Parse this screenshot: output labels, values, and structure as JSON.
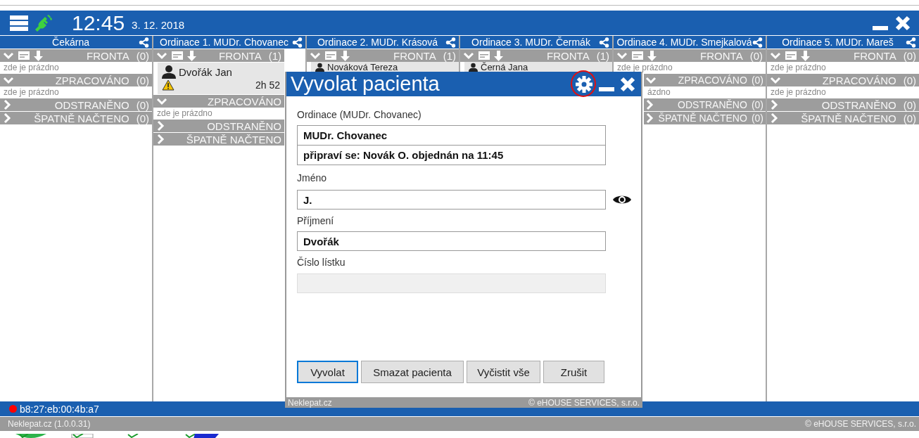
{
  "header": {
    "time": "12:45",
    "date": "3. 12. 2018",
    "connected": true
  },
  "columns": [
    {
      "title": "Čekárna",
      "sections": [
        {
          "kind": "queue",
          "label": "FRONTA",
          "count": "(0)",
          "expanded": true,
          "note": "zde je prázdno"
        },
        {
          "kind": "group",
          "label": "ZPRACOVÁNO",
          "count": "(0)",
          "expanded": true,
          "note": "zde je prázdno"
        },
        {
          "kind": "group",
          "label": "ODSTRANĚNO",
          "count": "(0)",
          "expanded": false
        },
        {
          "kind": "group",
          "label": "ŠPATNĚ NAČTENO",
          "count": "(0)",
          "expanded": false
        }
      ]
    },
    {
      "title": "Ordinace 1. MUDr. Chovanec",
      "sections": [
        {
          "kind": "queue",
          "label": "FRONTA",
          "count": "(1)",
          "expanded": true,
          "patients": [
            {
              "name": "Dvořák Jan",
              "warning": true,
              "wait": "2h 52"
            }
          ]
        },
        {
          "kind": "group",
          "label": "ZPRACOVÁNO",
          "expanded": true,
          "note": "zde je prázdno"
        },
        {
          "kind": "group",
          "label": "ODSTRANĚNO",
          "expanded": false
        },
        {
          "kind": "group",
          "label": "ŠPATNĚ NAČTENO",
          "expanded": false
        }
      ]
    },
    {
      "title": "Ordinace 2. MUDr. Krásová",
      "sections": [
        {
          "kind": "queue",
          "label": "FRONTA",
          "count": "(1)",
          "expanded": true,
          "patients": [
            {
              "name": "Nováková Tereza"
            }
          ]
        }
      ]
    },
    {
      "title": "Ordinace 3. MUDr. Čermák",
      "sections": [
        {
          "kind": "queue",
          "label": "FRONTA",
          "count": "(1)",
          "expanded": true,
          "patients": [
            {
              "name": "Černá Jana"
            }
          ]
        }
      ]
    },
    {
      "title": "Ordinace 4. MUDr. Smejkalová",
      "sections": [
        {
          "kind": "queue",
          "label": "FRONTA",
          "count": "(0)",
          "expanded": true,
          "note": "zde je prázdno"
        },
        {
          "kind": "group",
          "label": "ZPRACOVÁNO",
          "count": "(0)",
          "expanded": true,
          "note": "ázdno"
        },
        {
          "kind": "group",
          "label": "ODSTRANĚNO",
          "count": "(0)",
          "expanded": false
        },
        {
          "kind": "group",
          "label": "ŠPATNĚ NAČTENO",
          "count": "(0)",
          "expanded": false
        }
      ]
    },
    {
      "title": "Ordinace 5. MUDr. Mareš",
      "sections": [
        {
          "kind": "queue",
          "label": "FRONTA",
          "count": "(0)",
          "expanded": true,
          "note": "zde je prázdno"
        },
        {
          "kind": "group",
          "label": "ZPRACOVÁNO",
          "count": "(0)",
          "expanded": true,
          "note": "zde je prázdno"
        },
        {
          "kind": "group",
          "label": "ODSTRANĚNO",
          "count": "(0)",
          "expanded": false
        },
        {
          "kind": "group",
          "label": "ŠPATNĚ NAČTENO",
          "count": "(0)",
          "expanded": false
        }
      ]
    }
  ],
  "dialog": {
    "title": "Vyvolat pacienta",
    "settings_highlighted": true,
    "office_label": "Ordinace (MUDr. Chovanec)",
    "office_lines": [
      "MUDr. Chovanec",
      "připraví se: Novák O. objednán na 11:45"
    ],
    "fields": [
      {
        "label": "Jméno",
        "value": "J.",
        "disabled": false,
        "reveal_toggle": true
      },
      {
        "label": "Příjmení",
        "value": "Dvořák",
        "disabled": false,
        "reveal_toggle": false
      },
      {
        "label": "Číslo lístku",
        "disabled": true,
        "reveal_toggle": false
      }
    ],
    "buttons": [
      {
        "label": "Vyvolat",
        "focused": true
      },
      {
        "label": "Smazat pacienta",
        "focused": false
      },
      {
        "label": "Vyčistit vše",
        "focused": false
      },
      {
        "label": "Zrušit",
        "focused": false
      }
    ],
    "footer_left": "Neklepat.cz",
    "footer_right": "© eHOUSE SERVICES, s.r.o."
  },
  "status_bar": {
    "online": false,
    "address": "b8:27:eb:00:4b:a7"
  },
  "footer": {
    "left": "Neklepat.cz (1.0.0.31)",
    "right": "© eHOUSE SERVICES, s.r.o."
  }
}
